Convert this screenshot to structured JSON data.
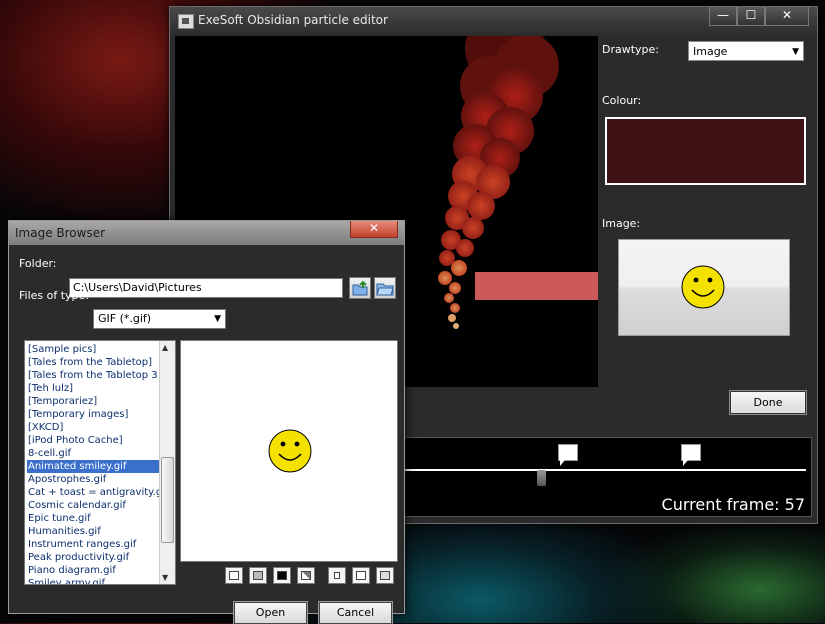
{
  "editor": {
    "title": "ExeSoft Obsidian particle editor",
    "window_buttons": {
      "minimize": "—",
      "maximize": "☐",
      "close": "✕"
    },
    "drawtype_label": "Drawtype:",
    "drawtype_value": "Image",
    "colour_label": "Colour:",
    "colour_value": "#3f1313",
    "image_label": "Image:",
    "done_label": "Done",
    "current_frame_label": "Current frame: 57"
  },
  "browser": {
    "title": "Image Browser",
    "close": "✕",
    "folder_label": "Folder:",
    "folder_value": "C:\\Users\\David\\Pictures",
    "files_type_label": "Files of type:",
    "files_type_value": "GIF (*.gif)",
    "files": [
      "[Sample pics]",
      "[Tales from the Tabletop]",
      "[Tales from the Tabletop 3",
      "[Teh lulz]",
      "[Temporariez]",
      "[Temporary images]",
      "[XKCD]",
      "[iPod Photo Cache]",
      "8-cell.gif",
      "Animated smiley.gif",
      "Apostrophes.gif",
      "Cat + toast = antigravity.g",
      "Cosmic calendar.gif",
      "Epic tune.gif",
      "Humanities.gif",
      "Instrument ranges.gif",
      "Peak productivity.gif",
      "Piano diagram.gif",
      "Smiley army.gif"
    ],
    "selected_file": "Animated smiley.gif",
    "open_label": "Open",
    "cancel_label": "Cancel"
  },
  "colors": {
    "selection": "#3a6fcb",
    "smiley": "#f5e100"
  }
}
